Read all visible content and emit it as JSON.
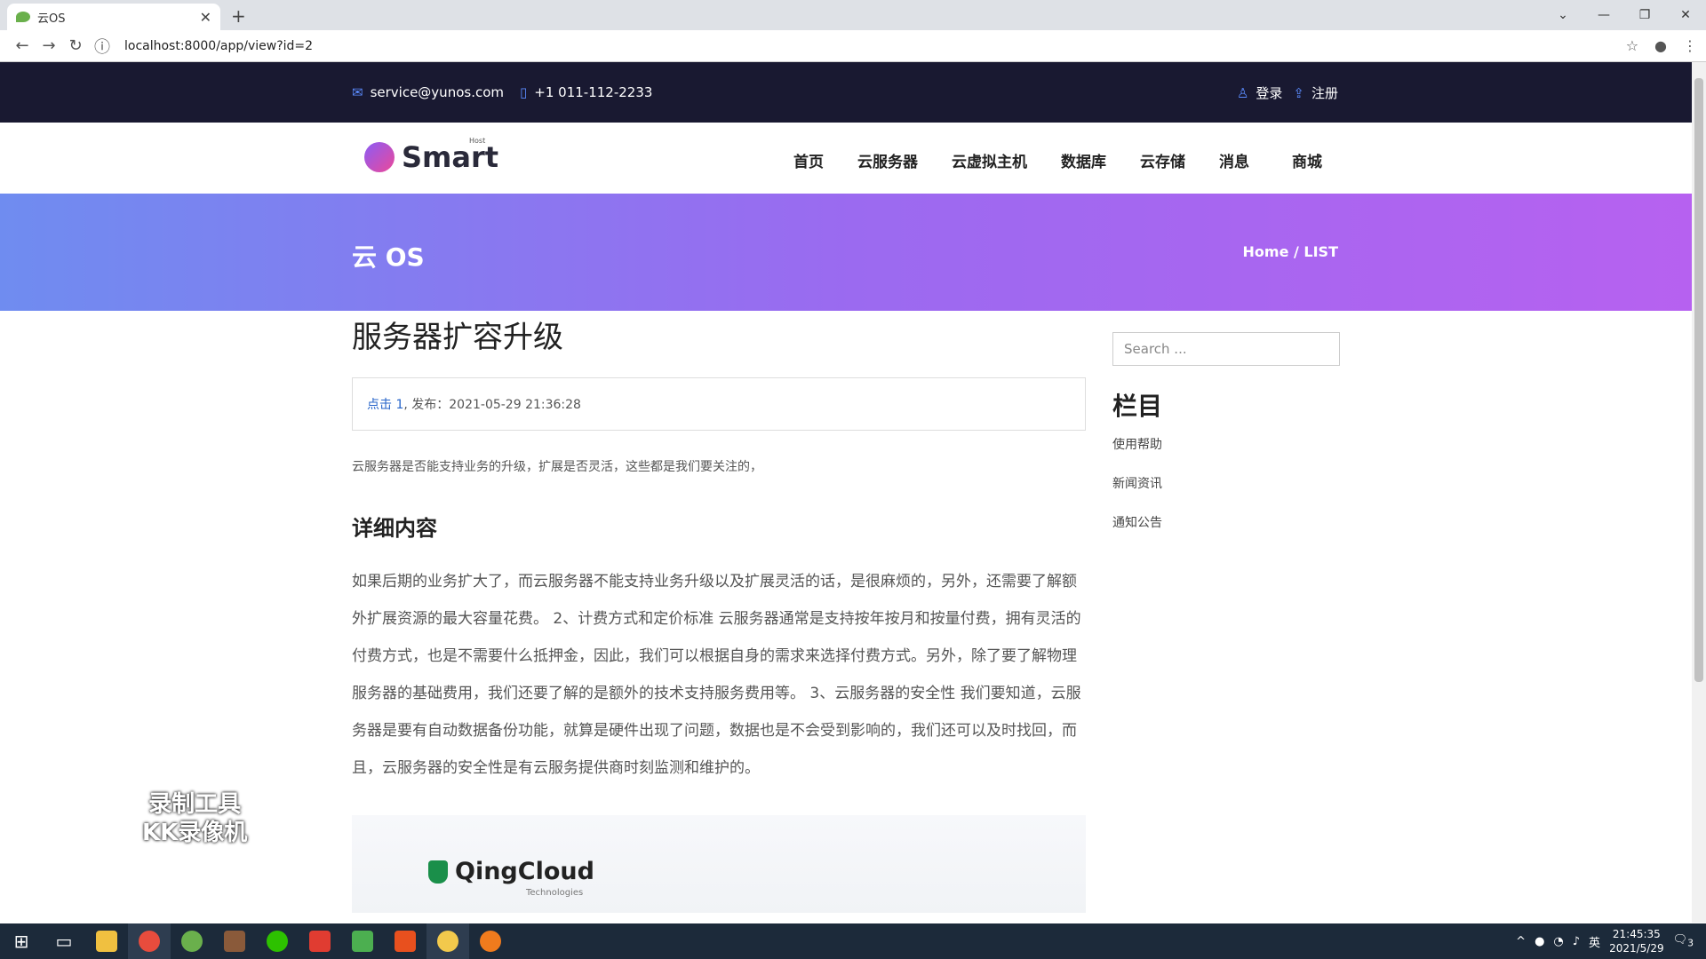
{
  "browser": {
    "tab_title": "云OS",
    "url": "localhost:8000/app/view?id=2"
  },
  "topbar": {
    "email": "service@yunos.com",
    "phone": "+1 011-112-2233",
    "login": "登录",
    "register": "注册"
  },
  "nav": {
    "logo": "Smart",
    "logo_sub": "Host",
    "items": [
      "首页",
      "云服务器",
      "云虚拟主机",
      "数据库",
      "云存储",
      "消息",
      "商城"
    ]
  },
  "hero": {
    "title": "云 OS",
    "breadcrumb": "Home / LIST"
  },
  "article": {
    "title": "服务器扩容升级",
    "meta_click": "点击 1",
    "meta_publish": ", 发布：2021-05-29 21:36:28",
    "intro": "云服务器是否能支持业务的升级，扩展是否灵活，这些都是我们要关注的，",
    "section_title": "详细内容",
    "body": "如果后期的业务扩大了，而云服务器不能支持业务升级以及扩展灵活的话，是很麻烦的，另外，还需要了解额外扩展资源的最大容量花费。 2、计费方式和定价标准 云服务器通常是支持按年按月和按量付费，拥有灵活的付费方式，也是不需要什么抵押金，因此，我们可以根据自身的需求来选择付费方式。另外，除了要了解物理服务器的基础费用，我们还要了解的是额外的技术支持服务费用等。 3、云服务器的安全性 我们要知道，云服务器是要有自动数据备份功能，就算是硬件出现了问题，数据也是不会受到影响的，我们还可以及时找回，而且，云服务器的安全性是有云服务提供商时刻监测和维护的。",
    "image_brand": "QingCloud",
    "image_brand_sub": "Technologies"
  },
  "sidebar": {
    "search_placeholder": "Search ...",
    "heading": "栏目",
    "items": [
      "使用帮助",
      "新闻资讯",
      "通知公告"
    ]
  },
  "watermark": {
    "line1": "录制工具",
    "line2": "KK录像机"
  },
  "taskbar": {
    "time": "21:45:35",
    "date": "2021/5/29",
    "ime": "英",
    "notification_count": "3"
  }
}
